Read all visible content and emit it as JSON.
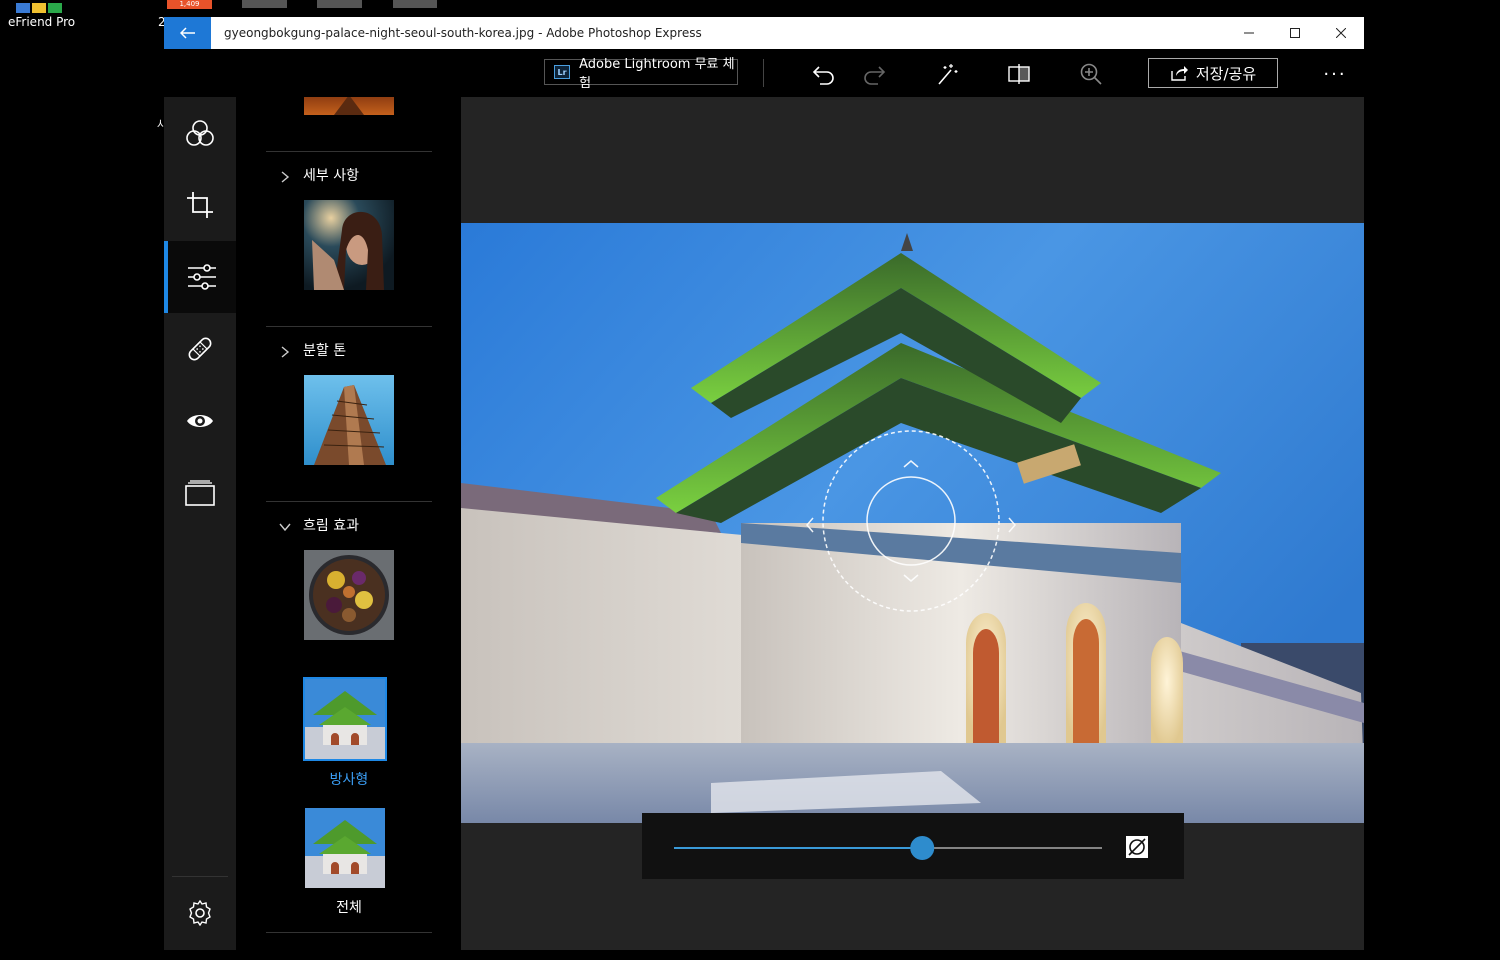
{
  "desktop": {
    "icon_label": "eFriend Pro",
    "badge_text": "1,409",
    "partial_label_1": "2",
    "partial_label_2": "사"
  },
  "window": {
    "title": "gyeongbokgung-palace-night-seoul-south-korea.jpg - Adobe Photoshop Express"
  },
  "toolbar": {
    "lightroom_label": "Adobe Lightroom 무료 체험",
    "lightroom_logo": "Lr",
    "save_label": "저장/공유",
    "more_label": "···"
  },
  "rail": {
    "items": [
      {
        "name": "looks",
        "icon": "circles-icon"
      },
      {
        "name": "crop",
        "icon": "crop-icon"
      },
      {
        "name": "adjustments",
        "icon": "sliders-icon",
        "active": true
      },
      {
        "name": "heal",
        "icon": "bandage-icon"
      },
      {
        "name": "red-eye",
        "icon": "eye-icon"
      },
      {
        "name": "borders",
        "icon": "frame-icon"
      }
    ],
    "settings_icon": "gear-icon"
  },
  "panel": {
    "sections": [
      {
        "label": "세부 사항",
        "expanded": false
      },
      {
        "label": "분할 톤",
        "expanded": false
      },
      {
        "label": "흐림 효과",
        "expanded": true
      }
    ],
    "blur_options": [
      {
        "label": "방사형",
        "selected": true
      },
      {
        "label": "전체",
        "selected": false
      }
    ]
  },
  "slider": {
    "value_fraction": 0.58
  },
  "colors": {
    "accent": "#1e88e5",
    "selected_text": "#3b9ef5",
    "titlebar_back": "#1e78d6"
  }
}
